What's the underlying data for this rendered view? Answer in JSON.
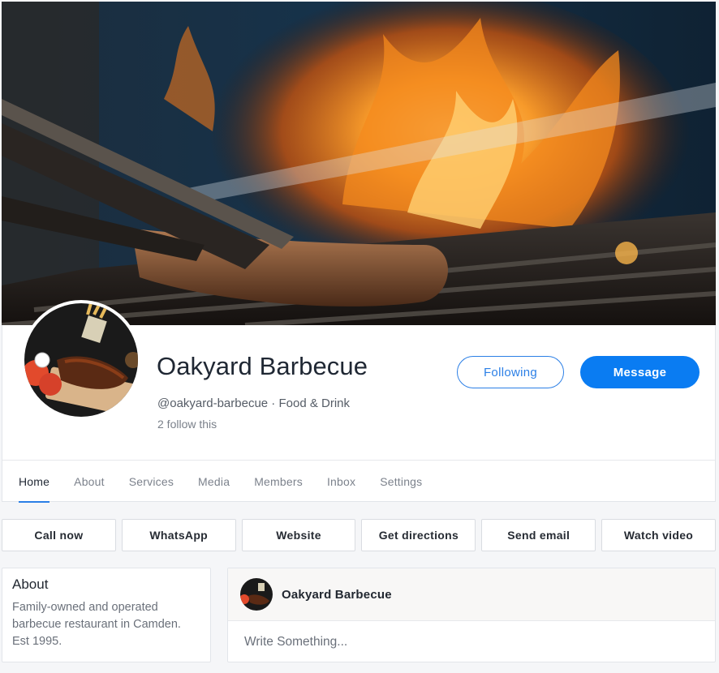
{
  "page": {
    "name": "Oakyard Barbecue",
    "handle_category": "@oakyard-barbecue · Food & Drink",
    "followers": "2 follow this"
  },
  "buttons": {
    "following": "Following",
    "message": "Message"
  },
  "tabs": [
    {
      "label": "Home",
      "active": true
    },
    {
      "label": "About"
    },
    {
      "label": "Services"
    },
    {
      "label": "Media"
    },
    {
      "label": "Members"
    },
    {
      "label": "Inbox"
    },
    {
      "label": "Settings"
    }
  ],
  "actions": [
    {
      "label": "Call now",
      "icon": "phone-icon"
    },
    {
      "label": "WhatsApp",
      "icon": "whatsapp-icon"
    },
    {
      "label": "Website",
      "icon": "globe-icon"
    },
    {
      "label": "Get directions",
      "icon": "directions-icon"
    },
    {
      "label": "Send email",
      "icon": "email-icon"
    },
    {
      "label": "Watch video",
      "icon": "video-icon"
    }
  ],
  "about": {
    "title": "About",
    "text": "Family-owned and operated barbecue restaurant in Camden. Est 1995."
  },
  "composer": {
    "author": "Oakyard Barbecue",
    "placeholder": "Write Something..."
  },
  "colors": {
    "accent": "#0a7cf2",
    "outline_accent": "#2b7fe6"
  }
}
